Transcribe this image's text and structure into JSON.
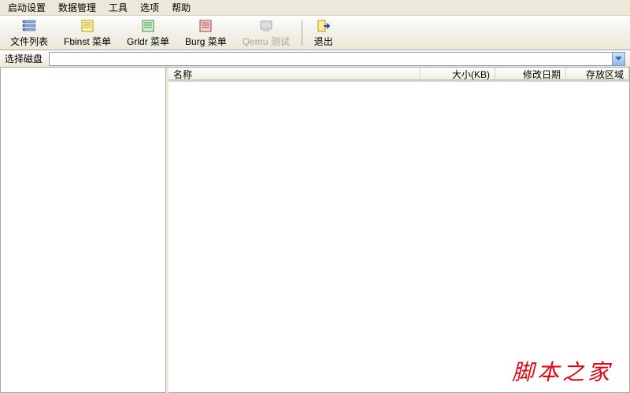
{
  "menu": {
    "boot_settings": "启动设置",
    "data_mgmt": "数据管理",
    "tools": "工具",
    "options": "选项",
    "help": "帮助"
  },
  "toolbar": {
    "file_list": "文件列表",
    "fbinst_menu": "Fbinst 菜单",
    "grldr_menu": "Grldr 菜单",
    "burg_menu": "Burg 菜单",
    "qemu_test": "Qemu 测试",
    "exit": "退出"
  },
  "diskbar": {
    "label": "选择磁盘",
    "value": ""
  },
  "columns": {
    "name": "名称",
    "size": "大小(KB)",
    "mtime": "修改日期",
    "area": "存放区域"
  },
  "icons": {
    "file_list": "file-list-icon",
    "fbinst": "fbinst-icon",
    "grldr": "grldr-icon",
    "burg": "burg-icon",
    "qemu": "qemu-icon",
    "exit": "exit-icon"
  },
  "watermark": "脚本之家",
  "colors": {
    "bg": "#ece9d8",
    "accent": "#316ac5",
    "watermark": "#e20613"
  }
}
